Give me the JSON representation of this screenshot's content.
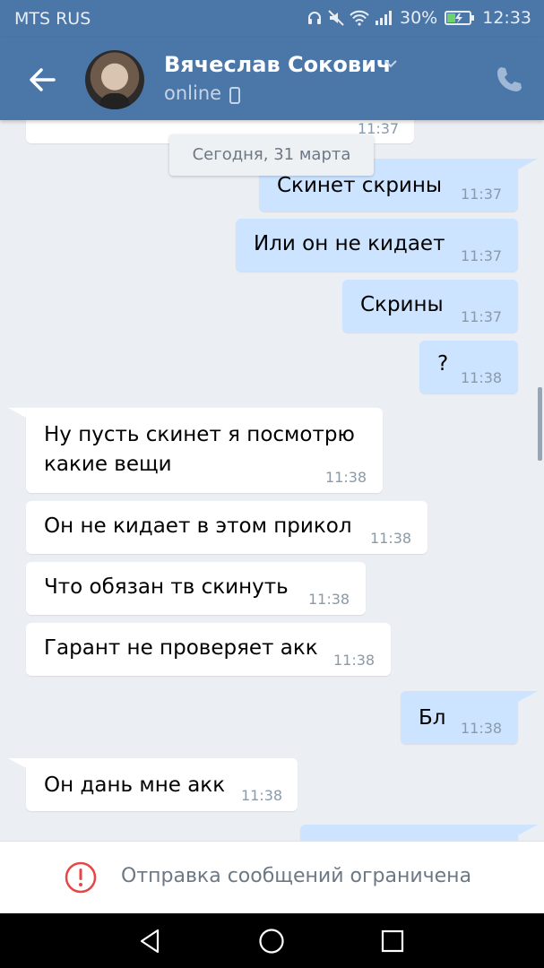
{
  "status_bar": {
    "carrier": "MTS RUS",
    "battery": "30%",
    "time": "12:33"
  },
  "header": {
    "contact_name": "Вячеслав Сокович",
    "status": "online"
  },
  "date_separator": "Сегодня, 31 марта",
  "messages": [
    {
      "dir": "in",
      "text": "",
      "time": "11:37"
    },
    {
      "dir": "out",
      "text": "Скинет скрины",
      "time": "11:37"
    },
    {
      "dir": "out",
      "text": "Или он не кидает",
      "time": "11:37"
    },
    {
      "dir": "out",
      "text": "Скрины",
      "time": "11:37"
    },
    {
      "dir": "out",
      "text": "?",
      "time": "11:38"
    },
    {
      "dir": "in",
      "text_lines": [
        "Ну пусть скинет я посмотрю",
        "какие вещи"
      ],
      "time": "11:38"
    },
    {
      "dir": "in",
      "text": "Он не кидает в этом прикол",
      "time": "11:38"
    },
    {
      "dir": "in",
      "text": "Что обязан тв скинуть",
      "time": "11:38"
    },
    {
      "dir": "in",
      "text": "Гарант не проверяет акк",
      "time": "11:38"
    },
    {
      "dir": "out",
      "text": "Бл",
      "time": "11:38"
    },
    {
      "dir": "in",
      "text": "Он дань мне акк",
      "time": "11:38"
    }
  ],
  "restriction_notice": "Отправка сообщений ограничена",
  "colors": {
    "header": "#4a76a8",
    "outgoing_bubble": "#cce4ff",
    "incoming_bubble": "#ffffff",
    "background": "#ebeef3",
    "alert_red": "#e64646"
  },
  "icons": [
    "back-arrow-icon",
    "chevron-down-icon",
    "mobile-phone-icon",
    "call-icon",
    "alert-icon",
    "nav-back-icon",
    "nav-home-icon",
    "nav-recents-icon"
  ]
}
